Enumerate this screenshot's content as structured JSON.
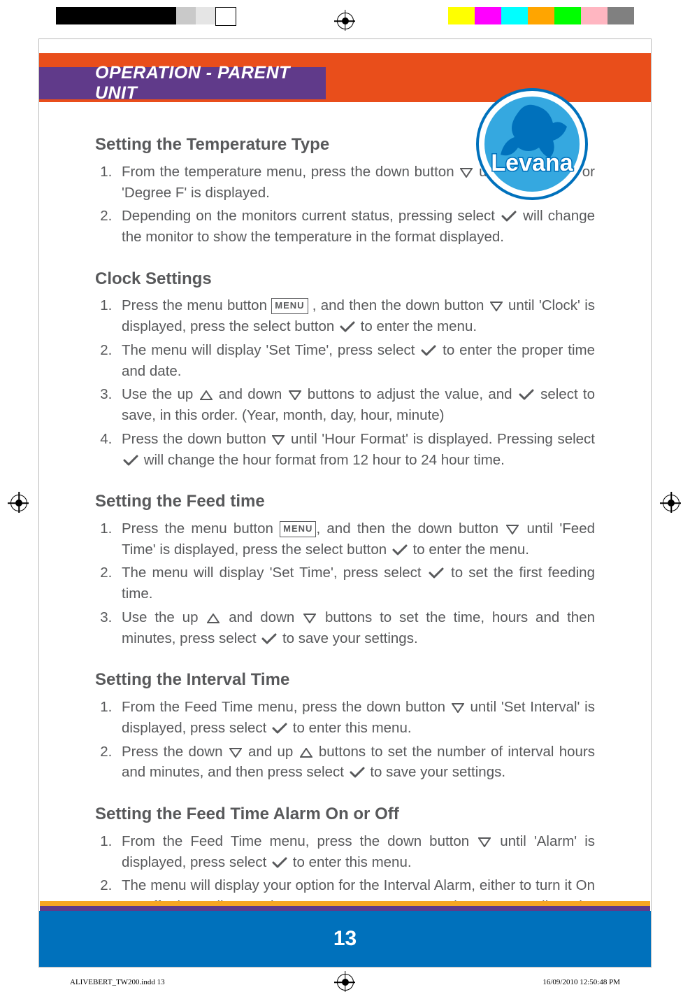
{
  "header": {
    "title": "OPERATION - PARENT UNIT",
    "logo_name": "Levana"
  },
  "sections": [
    {
      "title": "Setting the  Temperature Type",
      "items": [
        {
          "parts": [
            {
              "t": "From the temperature menu, press the down button "
            },
            {
              "icon": "down"
            },
            {
              "t": " until 'Degree C' or 'Degree F' is displayed."
            }
          ]
        },
        {
          "parts": [
            {
              "t": "Depending on the monitors current status, pressing select "
            },
            {
              "icon": "check"
            },
            {
              "t": " will change the monitor to show the temperature in the format displayed."
            }
          ]
        }
      ]
    },
    {
      "title": "Clock Settings",
      "items": [
        {
          "parts": [
            {
              "t": "Press the menu button "
            },
            {
              "icon": "menu"
            },
            {
              "t": " , and then the down button "
            },
            {
              "icon": "down"
            },
            {
              "t": " until 'Clock' is displayed, press the select button "
            },
            {
              "icon": "check"
            },
            {
              "t": " to enter the menu."
            }
          ]
        },
        {
          "parts": [
            {
              "t": "The menu will display 'Set Time', press select "
            },
            {
              "icon": "check"
            },
            {
              "t": " to enter the proper time and date."
            }
          ]
        },
        {
          "parts": [
            {
              "t": "Use the up "
            },
            {
              "icon": "up"
            },
            {
              "t": " and down "
            },
            {
              "icon": "down"
            },
            {
              "t": " buttons to adjust the value, and "
            },
            {
              "icon": "check"
            },
            {
              "t": " select  to save, in this order. (Year, month, day, hour, minute)"
            }
          ]
        },
        {
          "parts": [
            {
              "t": "Press the down button "
            },
            {
              "icon": "down"
            },
            {
              "t": " until 'Hour Format' is displayed. Pressing select "
            },
            {
              "icon": "check"
            },
            {
              "t": " will change the hour format from 12 hour to 24 hour time."
            }
          ]
        }
      ]
    },
    {
      "title": "Setting the Feed time",
      "items": [
        {
          "parts": [
            {
              "t": "Press the menu button "
            },
            {
              "icon": "menu"
            },
            {
              "t": ", and then the down button "
            },
            {
              "icon": "down"
            },
            {
              "t": " until 'Feed Time' is displayed, press the select button "
            },
            {
              "icon": "check"
            },
            {
              "t": " to enter the menu."
            }
          ]
        },
        {
          "parts": [
            {
              "t": "The menu will display 'Set Time', press select "
            },
            {
              "icon": "check"
            },
            {
              "t": " to set the first feeding time."
            }
          ]
        },
        {
          "parts": [
            {
              "t": "Use the up "
            },
            {
              "icon": "up"
            },
            {
              "t": " and down "
            },
            {
              "icon": "down"
            },
            {
              "t": " buttons to set the time, hours and then minutes, press select "
            },
            {
              "icon": "check"
            },
            {
              "t": " to save your settings."
            }
          ]
        }
      ]
    },
    {
      "title": "Setting the Interval Time",
      "items": [
        {
          "parts": [
            {
              "t": "From the Feed Time menu, press the down button "
            },
            {
              "icon": "down"
            },
            {
              "t": " until 'Set Interval' is displayed, press select "
            },
            {
              "icon": "check"
            },
            {
              "t": " to enter this menu."
            }
          ]
        },
        {
          "parts": [
            {
              "t": "Press the down "
            },
            {
              "icon": "down"
            },
            {
              "t": " and up "
            },
            {
              "icon": "up"
            },
            {
              "t": " buttons to set the number of interval hours and minutes, and then press select "
            },
            {
              "icon": "check"
            },
            {
              "t": " to save your settings."
            }
          ]
        }
      ]
    },
    {
      "title": "Setting the Feed Time Alarm On or Off",
      "items": [
        {
          "parts": [
            {
              "t": "From the Feed Time menu, press the down button "
            },
            {
              "icon": "down"
            },
            {
              "t": " until 'Alarm' is displayed, press select "
            },
            {
              "icon": "check"
            },
            {
              "t": " to enter this menu."
            }
          ]
        },
        {
          "parts": [
            {
              "t": "The menu will display your option for the Interval Alarm, either to turn it On or Off, depending on its current status. Press select "
            },
            {
              "icon": "check"
            },
            {
              "t": " to adjust the setting."
            }
          ]
        }
      ]
    }
  ],
  "page_number": "13",
  "slug": {
    "file": "ALIVEBERT_TW200.indd   13",
    "timestamp": "16/09/2010   12:50:48 PM"
  },
  "icons": {
    "menu_label": "MENU"
  },
  "color_bars_left": [
    "#000",
    "#000",
    "#000",
    "#000",
    "#c9c9c9",
    "#e5e5e5",
    "#fff"
  ],
  "color_bars_right": [
    "#ffff00",
    "#ff00ff",
    "#00ffff",
    "#ffa500",
    "#00ff00",
    "#ffb6c1",
    "#808080"
  ]
}
